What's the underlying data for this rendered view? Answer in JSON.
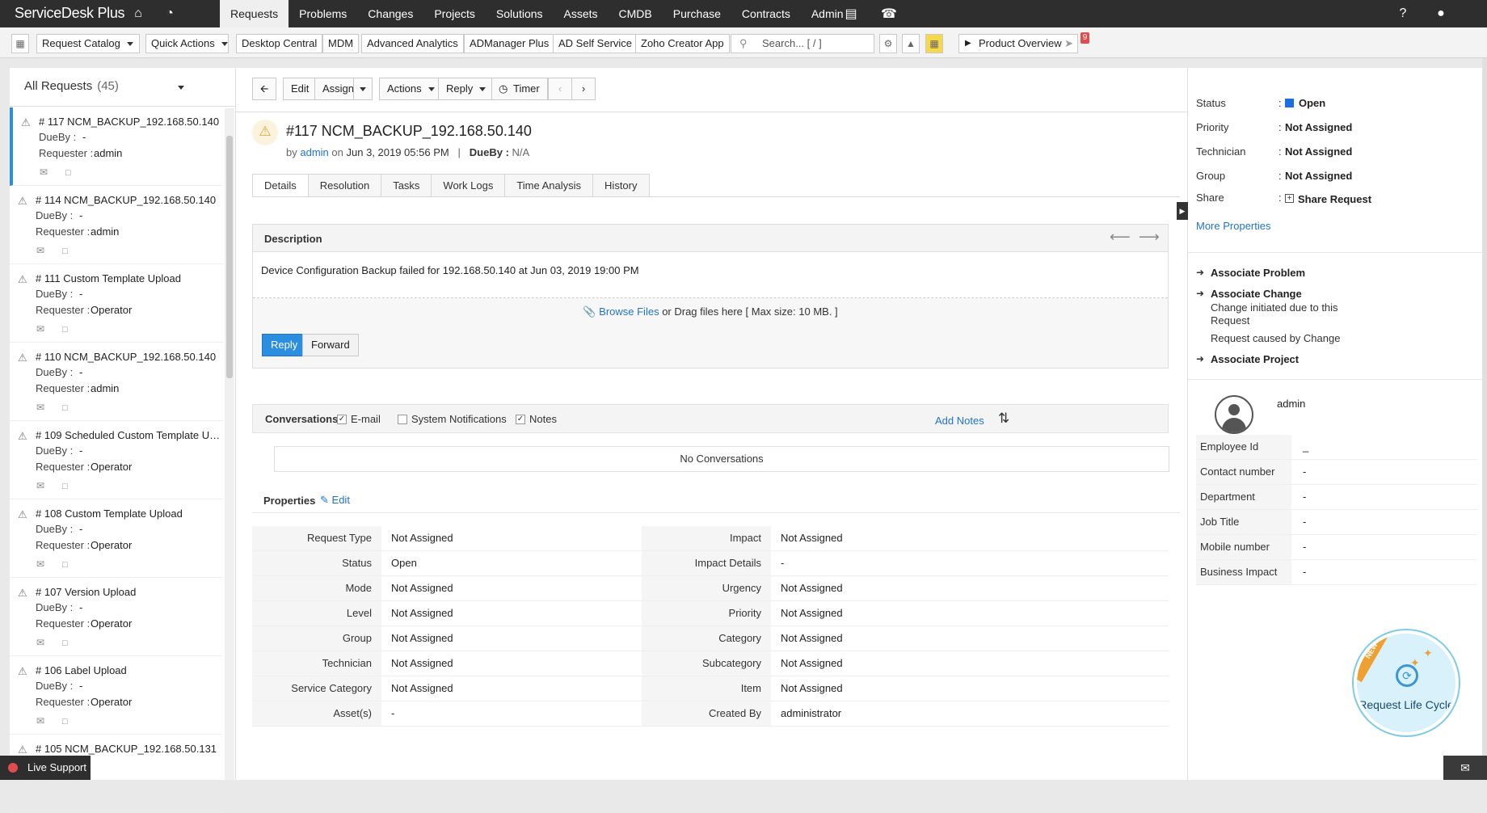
{
  "app": {
    "logo_main": "ServiceDesk",
    "logo_plus": "Plus"
  },
  "nav": {
    "items": [
      {
        "label": "Requests"
      },
      {
        "label": "Problems"
      },
      {
        "label": "Changes"
      },
      {
        "label": "Projects"
      },
      {
        "label": "Solutions"
      },
      {
        "label": "Assets"
      },
      {
        "label": "CMDB"
      },
      {
        "label": "Purchase"
      },
      {
        "label": "Contracts"
      },
      {
        "label": "Admin"
      }
    ],
    "active": "Requests"
  },
  "toolbar": {
    "request_catalog": "Request Catalog",
    "quick_actions": "Quick Actions",
    "desktop_central": "Desktop Central",
    "mdm": "MDM",
    "advanced_analytics": "Advanced Analytics",
    "admanager_plus": "ADManager Plus",
    "ad_self_service": "AD Self Service",
    "zoho_creator": "Zoho Creator App",
    "search_placeholder": "Search... [ / ]",
    "product_overview": "Product Overview",
    "notification_count": "9"
  },
  "left": {
    "view_title": "All Requests",
    "view_count": "(45)",
    "duebay_label": "DueBy :",
    "requester_label": "Requester :",
    "requests": [
      {
        "title": "# 117 NCM_BACKUP_192.168.50.140",
        "dueby": "-",
        "requester": "admin"
      },
      {
        "title": "# 114 NCM_BACKUP_192.168.50.140",
        "dueby": "-",
        "requester": "admin"
      },
      {
        "title": "# 111 Custom Template Upload",
        "dueby": "-",
        "requester": "Operator"
      },
      {
        "title": "# 110 NCM_BACKUP_192.168.50.140",
        "dueby": "-",
        "requester": "admin"
      },
      {
        "title": "# 109 Scheduled Custom Template Upload",
        "dueby": "-",
        "requester": "Operator"
      },
      {
        "title": "# 108 Custom Template Upload",
        "dueby": "-",
        "requester": "Operator"
      },
      {
        "title": "# 107 Version Upload",
        "dueby": "-",
        "requester": "Operator"
      },
      {
        "title": "# 106 Label Upload",
        "dueby": "-",
        "requester": "Operator"
      },
      {
        "title": "# 105 NCM_BACKUP_192.168.50.131",
        "dueby": "",
        "requester": ""
      }
    ],
    "live_support": "Live Support"
  },
  "actions": {
    "edit": "Edit",
    "assign": "Assign",
    "actions": "Actions",
    "reply": "Reply",
    "timer": "Timer"
  },
  "ticket": {
    "title": "#117  NCM_BACKUP_192.168.50.140",
    "by_label": "by",
    "author": "admin",
    "on_label": "on",
    "created": "Jun 3, 2019 05:56 PM",
    "sep": "|",
    "dueby_label": "DueBy :",
    "dueby": "N/A"
  },
  "tabs": [
    {
      "label": "Details"
    },
    {
      "label": "Resolution"
    },
    {
      "label": "Tasks"
    },
    {
      "label": "Work Logs"
    },
    {
      "label": "Time Analysis"
    },
    {
      "label": "History"
    }
  ],
  "description": {
    "header": "Description",
    "text": "Device Configuration Backup failed for 192.168.50.140 at Jun 03, 2019 19:00 PM",
    "browse": "Browse Files",
    "drag_text": " or Drag files here [ Max size: 10 MB. ]",
    "reply_btn": "Reply",
    "forward_btn": "Forward"
  },
  "conversations": {
    "label": "Conversations",
    "email": "E-mail",
    "system": "System Notifications",
    "notes": "Notes",
    "add_notes": "Add Notes",
    "empty": "No Conversations"
  },
  "properties": {
    "title": "Properties",
    "edit": "Edit",
    "rows": [
      {
        "l1": "Request Type",
        "v1": "Not Assigned",
        "l2": "Impact",
        "v2": "Not Assigned"
      },
      {
        "l1": "Status",
        "v1": "Open",
        "l2": "Impact Details",
        "v2": "-"
      },
      {
        "l1": "Mode",
        "v1": "Not Assigned",
        "l2": "Urgency",
        "v2": "Not Assigned"
      },
      {
        "l1": "Level",
        "v1": "Not Assigned",
        "l2": "Priority",
        "v2": "Not Assigned"
      },
      {
        "l1": "Group",
        "v1": "Not Assigned",
        "l2": "Category",
        "v2": "Not Assigned"
      },
      {
        "l1": "Technician",
        "v1": "Not Assigned",
        "l2": "Subcategory",
        "v2": "Not Assigned"
      },
      {
        "l1": "Service Category",
        "v1": "Not Assigned",
        "l2": "Item",
        "v2": "Not Assigned"
      },
      {
        "l1": "Asset(s)",
        "v1": "-",
        "l2": "Created By",
        "v2": "administrator"
      }
    ]
  },
  "right": {
    "status_label": "Status",
    "status": "Open",
    "priority_label": "Priority",
    "priority": "Not Assigned",
    "technician_label": "Technician",
    "technician": "Not Assigned",
    "group_label": "Group",
    "group": "Not Assigned",
    "share_label": "Share",
    "share": "Share Request",
    "colon": ":",
    "more_properties": "More Properties",
    "associate_problem": "Associate Problem",
    "associate_change": "Associate Change",
    "change_initiated": "Change initiated due to this Request",
    "caused_by_change": "Request caused by Change",
    "associate_project": "Associate Project",
    "requester_name": "admin",
    "user_fields": [
      {
        "k": "Employee Id",
        "v": "_"
      },
      {
        "k": "Contact number",
        "v": "-"
      },
      {
        "k": "Department",
        "v": "-"
      },
      {
        "k": "Job Title",
        "v": "-"
      },
      {
        "k": "Mobile number",
        "v": "-"
      },
      {
        "k": "Business Impact",
        "v": "-"
      }
    ],
    "lifecycle_badge": "NEW",
    "lifecycle": "Request Life Cycle"
  },
  "colors": {
    "accent": "#2b8ee0",
    "topbar": "#2e2e2e",
    "status_open": "#1c6fe0",
    "link": "#1f74c9"
  }
}
